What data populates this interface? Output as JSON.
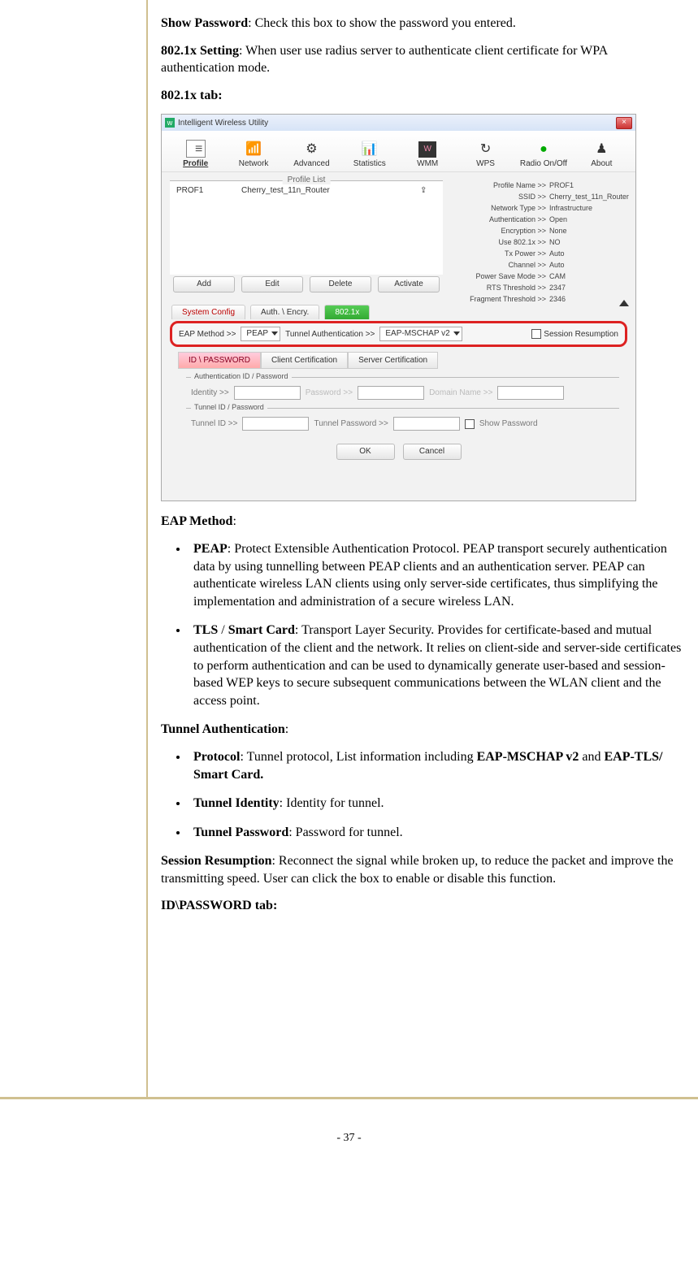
{
  "text": {
    "show_password_label": "Show Password",
    "show_password_desc": ": Check this box to show the password you entered.",
    "dot1x_setting_label": "802.1x Setting",
    "dot1x_setting_desc": ": When user use radius server to authenticate client certificate for WPA authentication mode.",
    "dot1x_tab_heading": "802.1x tab:",
    "eap_method_heading": "EAP Method",
    "bullets": {
      "peap_label": "PEAP",
      "peap_desc": ": Protect Extensible Authentication Protocol. PEAP transport securely authentication data by using tunnelling between PEAP clients and an authentication server. PEAP can authenticate wireless LAN clients using only server-side certificates, thus simplifying the implementation and administration of a secure wireless LAN.",
      "tls_label": "TLS",
      "tls_sep": " / ",
      "smartcard_label": "Smart Card",
      "tls_desc": ": Transport Layer Security. Provides for certificate-based and mutual authentication of the client and the network. It relies on client-side and server-side certificates to perform authentication and can be used to dynamically generate user-based and session-based WEP keys to secure subsequent communications between the WLAN client and the access point."
    },
    "tunnel_auth_heading": "Tunnel Authentication",
    "tunnel_bullets": {
      "protocol_label": "Protocol",
      "protocol_desc_a": ": Tunnel protocol, List information including ",
      "protocol_desc_b": "EAP-MSCHAP v2",
      "protocol_desc_c": " and ",
      "protocol_desc_d": "EAP-TLS/ Smart Card.",
      "identity_label": "Tunnel Identity",
      "identity_desc": ": Identity for tunnel.",
      "password_label": "Tunnel Password",
      "password_desc": ": Password for tunnel."
    },
    "session_label": "Session Resumption",
    "session_desc": ": Reconnect the signal while broken up, to reduce the packet and improve the transmitting speed. User can click the box to enable or disable this function.",
    "idpw_tab_heading": "ID\\PASSWORD tab:"
  },
  "screenshot": {
    "window_title": "Intelligent Wireless Utility",
    "close_x": "×",
    "toolbar": {
      "profile": "Profile",
      "network": "Network",
      "advanced": "Advanced",
      "statistics": "Statistics",
      "wmm": "WMM",
      "wps": "WPS",
      "radio": "Radio On/Off",
      "about": "About"
    },
    "profile_list_legend": "Profile List",
    "profile_entry_name": "PROF1",
    "profile_entry_ssid": "Cherry_test_11n_Router",
    "details": {
      "profile_name_lab": "Profile Name >>",
      "profile_name_val": "PROF1",
      "ssid_lab": "SSID >>",
      "ssid_val": "Cherry_test_11n_Router",
      "net_type_lab": "Network Type >>",
      "net_type_val": "Infrastructure",
      "auth_lab": "Authentication >>",
      "auth_val": "Open",
      "enc_lab": "Encryption >>",
      "enc_val": "None",
      "use1x_lab": "Use 802.1x >>",
      "use1x_val": "NO",
      "txpwr_lab": "Tx Power >>",
      "txpwr_val": "Auto",
      "chan_lab": "Channel >>",
      "chan_val": "Auto",
      "psm_lab": "Power Save Mode >>",
      "psm_val": "CAM",
      "rts_lab": "RTS Threshold >>",
      "rts_val": "2347",
      "frag_lab": "Fragment Threshold >>",
      "frag_val": "2346"
    },
    "buttons": {
      "add": "Add",
      "edit": "Edit",
      "delete": "Delete",
      "activate": "Activate",
      "ok": "OK",
      "cancel": "Cancel"
    },
    "cfg_tabs": {
      "system": "System Config",
      "auth": "Auth. \\ Encry.",
      "dot1x": "802.1x"
    },
    "dot1x_row": {
      "eap_lab": "EAP Method >>",
      "eap_val": "PEAP",
      "tunnel_lab": "Tunnel Authentication >>",
      "tunnel_val": "EAP-MSCHAP v2",
      "session": "Session Resumption"
    },
    "sub_tabs": {
      "idpw": "ID \\ PASSWORD",
      "client": "Client Certification",
      "server": "Server Certification"
    },
    "idpw": {
      "fs1_legend": "Authentication ID / Password",
      "identity_lab": "Identity >>",
      "password_lab": "Password >>",
      "domain_lab": "Domain Name >>",
      "fs2_legend": "Tunnel ID / Password",
      "tunnel_id_lab": "Tunnel ID >>",
      "tunnel_pw_lab": "Tunnel Password >>",
      "show_pw": "Show Password"
    }
  },
  "page_number": "- 37 -"
}
